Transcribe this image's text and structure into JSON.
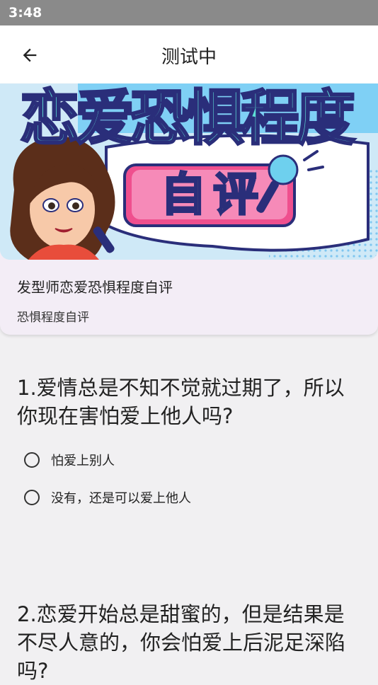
{
  "status_bar": {
    "time": "3:48"
  },
  "app_bar": {
    "title": "测试中"
  },
  "card": {
    "banner_title": "恋爱恐惧程度",
    "banner_subtitle": "自评",
    "title": "发型师恋爱恐惧程度自评",
    "subtitle": "恐惧程度自评"
  },
  "questions": [
    {
      "text": "1.爱情总是不知不觉就过期了，所以你现在害怕爱上他人吗?",
      "options": [
        "怕爱上别人",
        "没有，还是可以爱上他人"
      ]
    },
    {
      "text": "2.恋爱开始总是甜蜜的，但是结果是不尽人意的，你会怕爱上后泥足深陷吗?"
    }
  ],
  "colors": {
    "status_bar": "#8a8a8a",
    "app_bar": "#ffffff",
    "card_bg": "#f3edf6",
    "page_bg": "#f1f0f2"
  }
}
